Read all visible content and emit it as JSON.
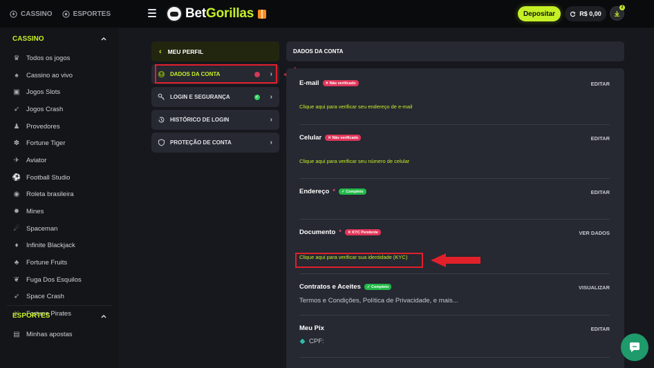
{
  "topnav": {
    "casino": "CASSINO",
    "esportes": "ESPORTES"
  },
  "header": {
    "logo_part1": "Bet",
    "logo_part2": "Gorillas",
    "deposit_label": "Depositar",
    "balance": "R$ 0,00",
    "notification_count": "2"
  },
  "sidebar": {
    "casino_section": "CASSINO",
    "items": [
      {
        "label": "Todos os jogos",
        "icon": "crown-icon"
      },
      {
        "label": "Cassino ao vivo",
        "icon": "cards-icon"
      },
      {
        "label": "Jogos Slots",
        "icon": "slots-icon"
      },
      {
        "label": "Jogos Crash",
        "icon": "rocket-icon"
      },
      {
        "label": "Provedores",
        "icon": "person-icon"
      },
      {
        "label": "Fortune Tiger",
        "icon": "paw-icon"
      },
      {
        "label": "Aviator",
        "icon": "plane-icon"
      },
      {
        "label": "Football Studio",
        "icon": "ball-icon"
      },
      {
        "label": "Roleta brasileira",
        "icon": "roulette-icon"
      },
      {
        "label": "Mines",
        "icon": "mine-icon"
      },
      {
        "label": "Spaceman",
        "icon": "spaceman-icon"
      },
      {
        "label": "Infinite Blackjack",
        "icon": "blackjack-icon"
      },
      {
        "label": "Fortune Fruits",
        "icon": "fruit-icon"
      },
      {
        "label": "Fuga Dos Esquilos",
        "icon": "squirrel-icon"
      },
      {
        "label": "Space Crash",
        "icon": "rocket-icon"
      },
      {
        "label": "Fortune Pirates",
        "icon": "swords-icon"
      }
    ],
    "esportes_section": "ESPORTES",
    "esportes_items": [
      {
        "label": "Minhas apostas",
        "icon": "ticket-icon"
      }
    ]
  },
  "profile_menu": {
    "title": "MEU PERFIL",
    "items": [
      {
        "label": "DADOS DA CONTA",
        "status": "red"
      },
      {
        "label": "LOGIN E SEGURANÇA",
        "status": "green"
      },
      {
        "label": "HISTÓRICO DE LOGIN",
        "status": ""
      },
      {
        "label": "PROTEÇÃO DE CONTA",
        "status": ""
      }
    ]
  },
  "account": {
    "title": "DADOS DA CONTA",
    "email": {
      "title": "E-mail",
      "badge": "✕ Não verificado",
      "action": "EDITAR",
      "link": "Clique aqui para verificar seu endereço de e-mail"
    },
    "phone": {
      "title": "Celular",
      "badge": "✕ Não verificado",
      "action": "EDITAR",
      "link": "Clique aqui para verificar seu número de celular"
    },
    "address": {
      "title": "Endereço",
      "req": "*",
      "badge": "✓ Completo",
      "action": "EDITAR"
    },
    "document": {
      "title": "Documento",
      "req": "*",
      "badge": "✕ KYC Pendente",
      "action": "VER DADOS",
      "link": "Clique aqui para verificar sua identidade (KYC)"
    },
    "contracts": {
      "title": "Contratos e Aceites",
      "badge": "✓ Completo",
      "action": "VISUALIZAR",
      "text": "Termos e Condições, Política de Privacidade, e mais..."
    },
    "pix": {
      "title": "Meu Pix",
      "action": "EDITAR",
      "text": "CPF:"
    }
  },
  "colors": {
    "accent": "#c5f026",
    "danger": "#e0365a",
    "success": "#22b948",
    "annotation": "#e2202a"
  }
}
